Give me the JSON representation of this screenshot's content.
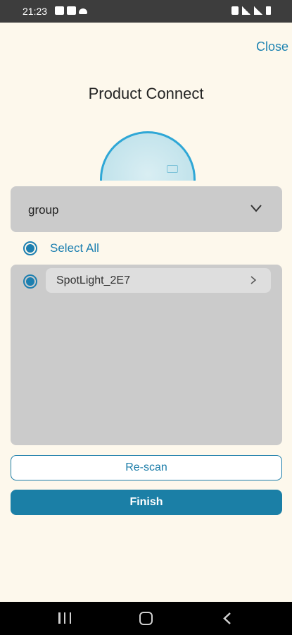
{
  "status_bar": {
    "time": "21:23",
    "left_icons": [
      "youtube-icon",
      "image-icon",
      "cloud-icon"
    ],
    "right_icons": [
      "mute-icon",
      "wifi-icon",
      "signal-icon",
      "battery-icon"
    ]
  },
  "header": {
    "close_label": "Close",
    "title": "Product Connect"
  },
  "group_selector": {
    "selected": "group"
  },
  "select_all": {
    "label": "Select All",
    "checked": true
  },
  "devices": [
    {
      "name": "SpotLight_2E7",
      "selected": true
    }
  ],
  "buttons": {
    "rescan_label": "Re-scan",
    "finish_label": "Finish"
  },
  "colors": {
    "accent": "#1c7fb0",
    "background": "#fdf8ec",
    "panel": "#cbcbcb"
  }
}
